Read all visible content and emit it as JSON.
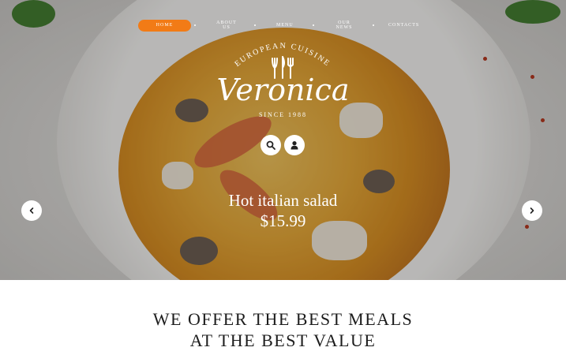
{
  "nav": {
    "items": [
      {
        "label": "HOME",
        "active": true
      },
      {
        "label": "ABOUT US",
        "active": false
      },
      {
        "label": "MENU",
        "active": false
      },
      {
        "label": "OUR NEWS",
        "active": false
      },
      {
        "label": "CONTACTS",
        "active": false
      }
    ],
    "active_color": "#f27b16"
  },
  "logo": {
    "tagline": "EUROPEAN CUISINE",
    "name": "Veronica",
    "since": "SINCE 1988"
  },
  "hero_actions": {
    "search_icon": "search-icon",
    "user_icon": "user-icon"
  },
  "slide": {
    "dish_name": "Hot italian salad",
    "price": "$15.99"
  },
  "carousel": {
    "prev_icon": "chevron-left-icon",
    "next_icon": "chevron-right-icon"
  },
  "section": {
    "headline_line1": "WE OFFER THE BEST MEALS",
    "headline_line2": "AT THE BEST VALUE"
  }
}
